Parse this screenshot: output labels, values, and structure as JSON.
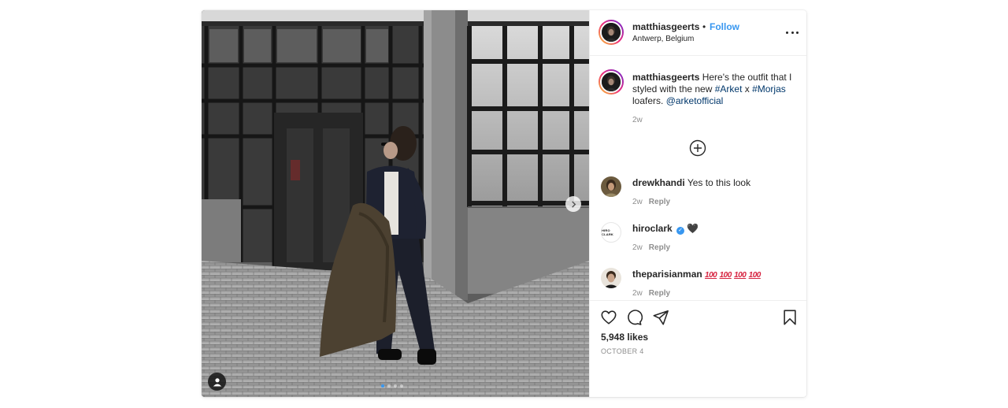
{
  "post": {
    "user": "matthiasgeerts",
    "separator": "•",
    "follow_label": "Follow",
    "location": "Antwerp, Belgium",
    "more_icon": "more-options-icon",
    "carousel_dots": 4,
    "carousel_active": 1
  },
  "caption": {
    "user": "matthiasgeerts",
    "text_1": " Here's the outfit that I styled with the new ",
    "tag_1": "#Arket",
    "text_2": " x ",
    "tag_2": "#Morjas",
    "text_3": " loafers. ",
    "mention": "@arketofficial",
    "time": "2w"
  },
  "comments": [
    {
      "user": "drewkhandi",
      "text": "Yes to this look",
      "time": "2w",
      "reply_label": "Reply"
    },
    {
      "user": "hiroclark",
      "verified_mark": "✓",
      "emoji": "🖤",
      "time": "2w",
      "reply_label": "Reply",
      "avatar_text": "HIRO CLARK"
    },
    {
      "user": "theparisianman",
      "emoji": "100",
      "emoji_repeat": 4,
      "time": "2w",
      "reply_label": "Reply"
    }
  ],
  "likes": "5,948 likes",
  "date": "OCTOBER 4",
  "colors": {
    "link": "#3897f0",
    "hashtag": "#00376b",
    "muted": "#8e8e8e",
    "text": "#262626"
  }
}
